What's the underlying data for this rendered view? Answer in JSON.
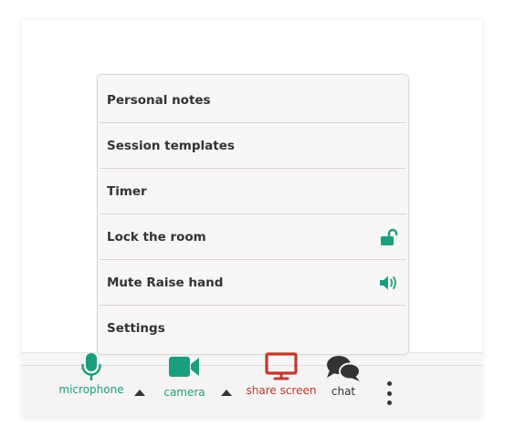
{
  "menu": {
    "items": [
      {
        "label": "Personal notes",
        "icon": ""
      },
      {
        "label": "Session templates",
        "icon": ""
      },
      {
        "label": "Timer",
        "icon": ""
      },
      {
        "label": "Lock the room",
        "icon": "unlocked-padlock-icon"
      },
      {
        "label": "Mute Raise hand",
        "icon": "speaker-volume-icon"
      },
      {
        "label": "Settings",
        "icon": ""
      }
    ]
  },
  "toolbar": {
    "microphone_label": "microphone",
    "camera_label": "camera",
    "share_screen_label": "share screen",
    "chat_label": "chat"
  },
  "colors": {
    "accent_green": "#1a9e80",
    "share_red": "#c0392b",
    "dark": "#333333",
    "menu_bg": "#f8f6f6",
    "toolbar_bg": "#f5f3f3"
  }
}
